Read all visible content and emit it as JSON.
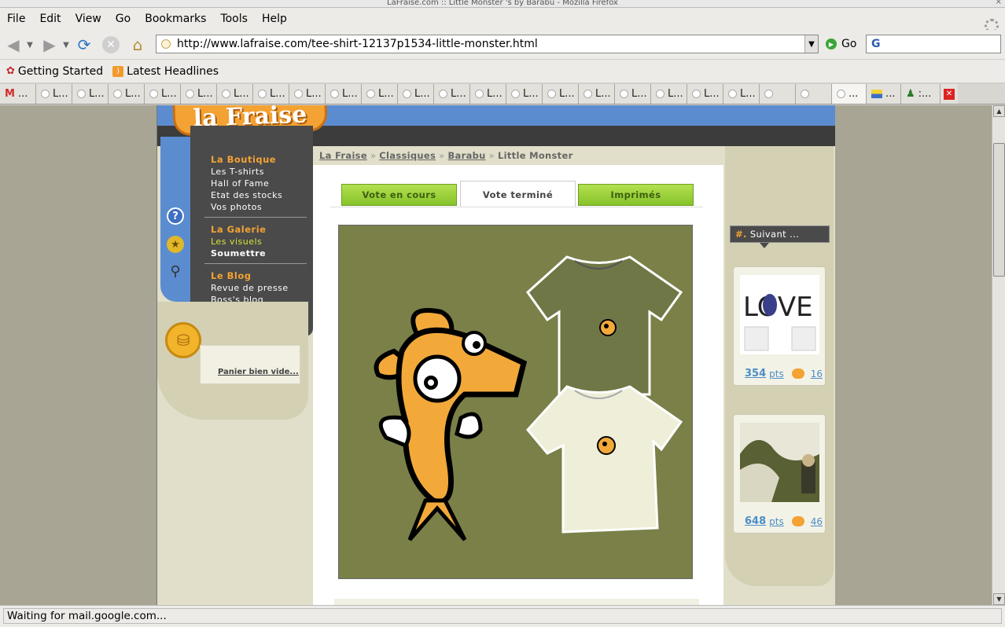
{
  "window": {
    "title": "LaFraise.com :: Little Monster 's by Barabu - Mozilla Firefox"
  },
  "menubar": [
    "File",
    "Edit",
    "View",
    "Go",
    "Bookmarks",
    "Tools",
    "Help"
  ],
  "navbar": {
    "url": "http://www.lafraise.com/tee-shirt-12137p1534-little-monster.html",
    "go_label": "Go",
    "search_value": ""
  },
  "bookmarks": [
    {
      "label": "Getting Started",
      "icon": "firefox-icon"
    },
    {
      "label": "Latest Headlines",
      "icon": "rss-icon"
    }
  ],
  "tabs": {
    "gmail": "...",
    "short": [
      "L...",
      "L...",
      "L...",
      "L...",
      "L...",
      "L...",
      "L...",
      "L...",
      "L...",
      "L...",
      "L...",
      "L...",
      "L...",
      "L...",
      "L...",
      "L...",
      "L...",
      "L...",
      "L...",
      "L..."
    ],
    "active": "...",
    "flag": "...",
    "shirt": ":..."
  },
  "site": {
    "logo_text": "la Fraise",
    "menu": {
      "boutique": {
        "head": "La Boutique",
        "items": [
          "Les T-shirts",
          "Hall of Fame",
          "Etat des stocks",
          "Vos photos"
        ]
      },
      "galerie": {
        "head": "La Galerie",
        "items": [
          "Les visuels",
          "Soumettre"
        ]
      },
      "blog": {
        "head": "Le Blog",
        "items": [
          "Revue de presse",
          "Boss's blog"
        ]
      }
    },
    "cart_link": "Panier bien vide...",
    "breadcrumb": {
      "items": [
        "La Fraise",
        "Classiques",
        "Barabu"
      ],
      "current": "Little Monster",
      "sep": "»"
    },
    "tabs": [
      "Vote en cours",
      "Vote terminé",
      "Imprimés"
    ],
    "next_label": "Suivant ...",
    "next_hash": "#.",
    "cards": [
      {
        "pts": "354",
        "pts_label": "pts",
        "comments": "16",
        "thumb_text": "LOVE"
      },
      {
        "pts": "648",
        "pts_label": "pts",
        "comments": "46"
      }
    ],
    "colors": {
      "orange": "#f3a233",
      "green_tab": "#9fd23c",
      "art_bg": "#7a8048",
      "dark_menu": "#4a4a4a"
    }
  },
  "status": "Waiting for mail.google.com..."
}
